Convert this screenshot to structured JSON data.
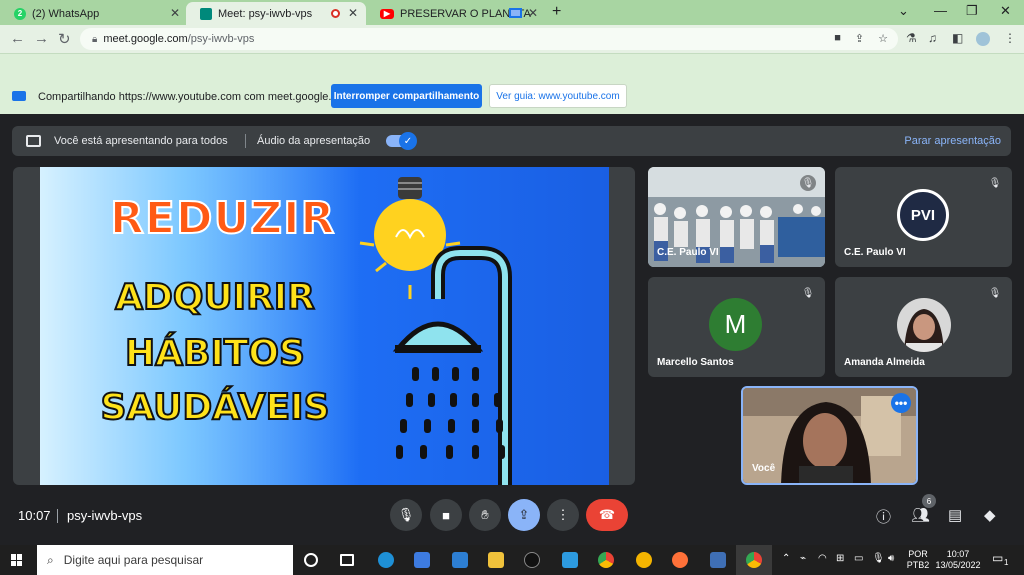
{
  "browser": {
    "tabs": [
      {
        "title": "(2) WhatsApp",
        "icon": "whatsapp-icon",
        "color": "#25d366"
      },
      {
        "title": "Meet: psy-iwvb-vps",
        "icon": "meet-icon",
        "color": "#00897b"
      },
      {
        "title": "PRESERVAR O PLANETA COM",
        "icon": "youtube-icon",
        "color": "#ff0000"
      }
    ],
    "url_host": "meet.google.com",
    "url_path": "/psy-iwvb-vps"
  },
  "sharing_bar": {
    "message": "Compartilhando https://www.youtube.com com meet.google.com",
    "stop_button": "Interromper compartilhamento",
    "view_button": "Ver guia: www.youtube.com"
  },
  "presenting_bar": {
    "message": "Você está apresentando para todos",
    "audio_label": "Áudio da apresentação",
    "audio_on": true,
    "stop_label": "Parar apresentação"
  },
  "slide": {
    "heading": "REDUZIR",
    "lines": [
      "ADQUIRIR",
      "HÁBITOS",
      "SAUDÁVEIS"
    ]
  },
  "participants": [
    {
      "name": "C.E. Paulo VI",
      "kind": "video-classroom",
      "muted": true
    },
    {
      "name": "C.E. Paulo VI",
      "kind": "logo",
      "muted": true,
      "logo_text": "PVI"
    },
    {
      "name": "Marcello Santos",
      "kind": "initial",
      "initial": "M",
      "muted": true
    },
    {
      "name": "Amanda Almeida",
      "kind": "photo",
      "muted": true
    },
    {
      "name": "Você",
      "kind": "self-video",
      "muted": false
    }
  ],
  "meeting": {
    "time": "10:07",
    "code": "psy-iwvb-vps",
    "participant_count": "6"
  },
  "taskbar": {
    "search_placeholder": "Digite aqui para pesquisar",
    "lang_top": "POR",
    "lang_bottom": "PTB2",
    "clock_time": "10:07",
    "clock_date": "13/05/2022",
    "notification_count": "1"
  }
}
